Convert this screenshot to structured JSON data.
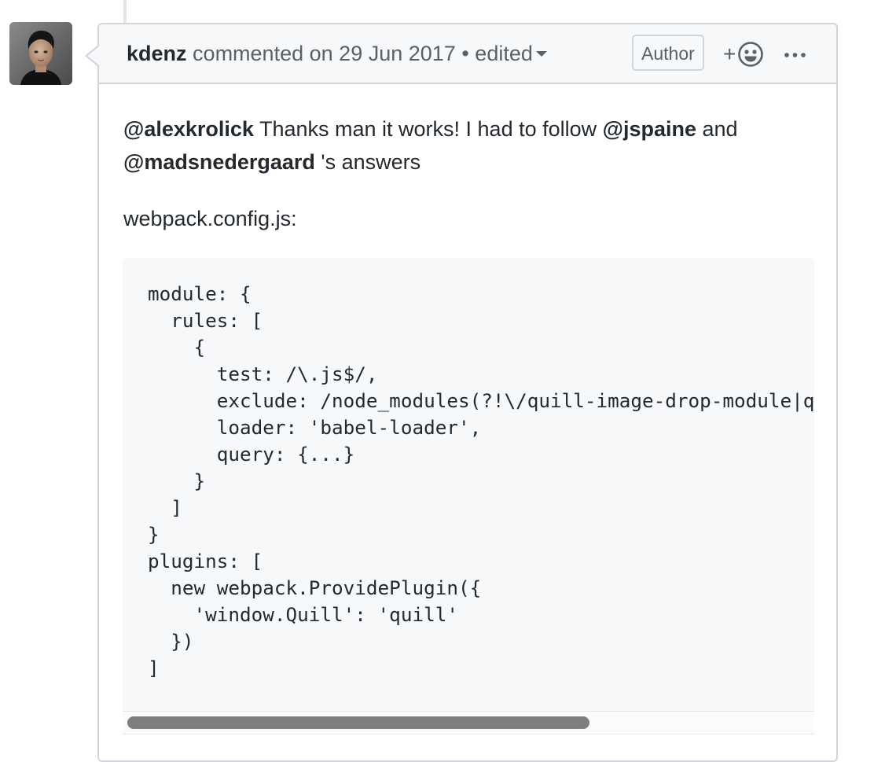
{
  "comment": {
    "author": "kdenz",
    "action": "commented on",
    "date": "29 Jun 2017",
    "separator": "•",
    "edited_label": "edited",
    "badge": "Author",
    "reaction_plus": "+",
    "icons": {
      "edited_dropdown": "chevron-down-icon",
      "reaction": "smiley-icon",
      "more": "kebab-horizontal-icon"
    },
    "body": {
      "mention1": "@alexkrolick",
      "text1": " Thanks man it works! I had to follow ",
      "mention2": "@jspaine",
      "text2": " and",
      "mention3": "@madsnedergaard",
      "text3": " 's answers",
      "config_label": "webpack.config.js:"
    },
    "code": "module: {\n  rules: [\n    {\n      test: /\\.js$/,\n      exclude: /node_modules(?!\\/quill-image-drop-module|quill-image-resize-module)/,\n      loader: 'babel-loader',\n      query: {...}\n    }\n  ]\n}\nplugins: [\n  new webpack.ProvidePlugin({\n    'window.Quill': 'quill'\n  })\n]",
    "code_scroll_fraction": 0.67
  },
  "colors": {
    "border": "#d1d5da",
    "header_bg": "#f6f8fa",
    "code_bg": "#f6f8fa",
    "text": "#24292e",
    "muted": "#586069",
    "scroll_thumb": "#7f7f7f"
  }
}
